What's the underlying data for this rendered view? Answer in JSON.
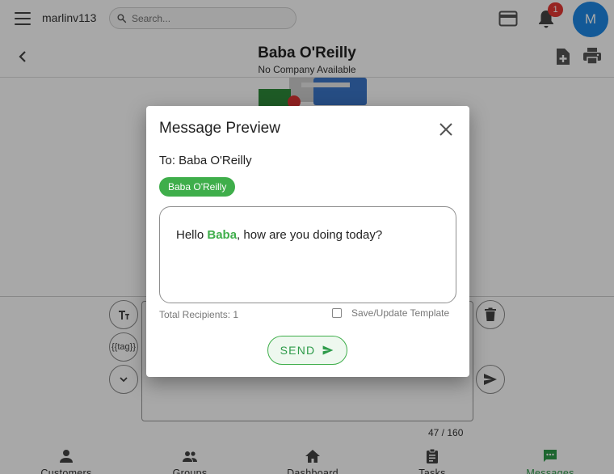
{
  "topbar": {
    "username": "marlinv113",
    "search_placeholder": "Search...",
    "notification_count": "1",
    "avatar_initial": "M"
  },
  "contact": {
    "name": "Baba O'Reilly",
    "company": "No Company Available"
  },
  "composer": {
    "tag_button_label": "{{tag}}",
    "char_count": "47 / 160"
  },
  "nav": {
    "items": [
      {
        "label": "Customers",
        "icon": "person-icon"
      },
      {
        "label": "Groups",
        "icon": "groups-icon"
      },
      {
        "label": "Dashboard",
        "icon": "home-icon"
      },
      {
        "label": "Tasks",
        "icon": "clipboard-icon"
      },
      {
        "label": "Messages",
        "icon": "chat-icon"
      }
    ],
    "active": "Messages"
  },
  "dialog": {
    "title": "Message Preview",
    "to_line": "To: Baba O'Reilly",
    "recipient_chip": "Baba O'Reilly",
    "message": {
      "prefix": "Hello ",
      "tag": "Baba",
      "suffix": ", how are you doing today?"
    },
    "total_recipients": "Total Recipients: 1",
    "save_template_label": "Save/Update Template",
    "send_label": "SEND"
  },
  "colors": {
    "accent_green": "#3fae4b",
    "avatar_blue": "#1e88e5",
    "badge_red": "#e53935"
  }
}
